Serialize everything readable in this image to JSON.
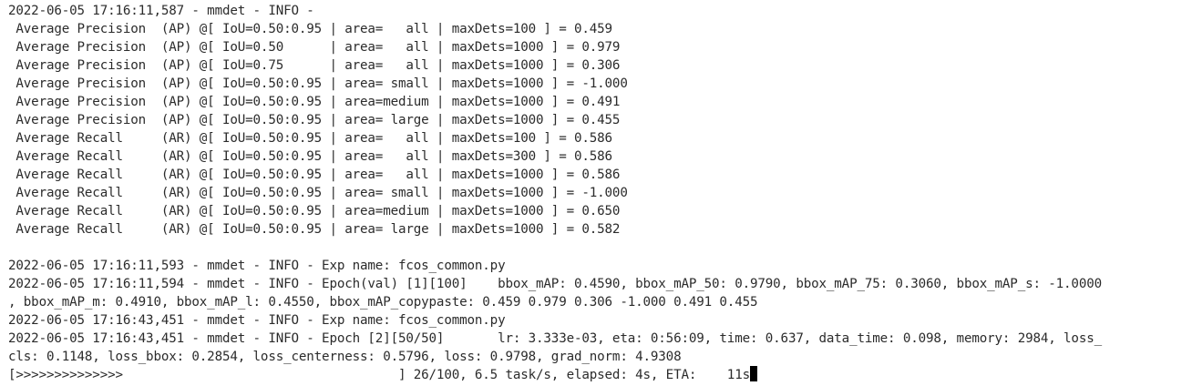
{
  "terminal": {
    "lines": [
      "2022-06-05 17:16:11,587 - mmdet - INFO -",
      " Average Precision  (AP) @[ IoU=0.50:0.95 | area=   all | maxDets=100 ] = 0.459",
      " Average Precision  (AP) @[ IoU=0.50      | area=   all | maxDets=1000 ] = 0.979",
      " Average Precision  (AP) @[ IoU=0.75      | area=   all | maxDets=1000 ] = 0.306",
      " Average Precision  (AP) @[ IoU=0.50:0.95 | area= small | maxDets=1000 ] = -1.000",
      " Average Precision  (AP) @[ IoU=0.50:0.95 | area=medium | maxDets=1000 ] = 0.491",
      " Average Precision  (AP) @[ IoU=0.50:0.95 | area= large | maxDets=1000 ] = 0.455",
      " Average Recall     (AR) @[ IoU=0.50:0.95 | area=   all | maxDets=100 ] = 0.586",
      " Average Recall     (AR) @[ IoU=0.50:0.95 | area=   all | maxDets=300 ] = 0.586",
      " Average Recall     (AR) @[ IoU=0.50:0.95 | area=   all | maxDets=1000 ] = 0.586",
      " Average Recall     (AR) @[ IoU=0.50:0.95 | area= small | maxDets=1000 ] = -1.000",
      " Average Recall     (AR) @[ IoU=0.50:0.95 | area=medium | maxDets=1000 ] = 0.650",
      " Average Recall     (AR) @[ IoU=0.50:0.95 | area= large | maxDets=1000 ] = 0.582",
      "",
      "2022-06-05 17:16:11,593 - mmdet - INFO - Exp name: fcos_common.py",
      "2022-06-05 17:16:11,594 - mmdet - INFO - Epoch(val) [1][100]    bbox_mAP: 0.4590, bbox_mAP_50: 0.9790, bbox_mAP_75: 0.3060, bbox_mAP_s: -1.0000",
      ", bbox_mAP_m: 0.4910, bbox_mAP_l: 0.4550, bbox_mAP_copypaste: 0.459 0.979 0.306 -1.000 0.491 0.455",
      "2022-06-05 17:16:43,451 - mmdet - INFO - Exp name: fcos_common.py",
      "2022-06-05 17:16:43,451 - mmdet - INFO - Epoch [2][50/50]       lr: 3.333e-03, eta: 0:56:09, time: 0.637, data_time: 0.098, memory: 2984, loss_",
      "cls: 0.1148, loss_bbox: 0.2854, loss_centerness: 0.5796, loss: 0.9798, grad_norm: 4.9308"
    ],
    "progress_line": "[>>>>>>>>>>>>>>                                    ] 26/100, 6.5 task/s, elapsed: 4s, ETA:    11s",
    "progress": {
      "completed": 26,
      "total": 100
    },
    "colors": {
      "background": "#ffffff",
      "text": "#2b2b2b",
      "cursor": "#000000"
    }
  }
}
